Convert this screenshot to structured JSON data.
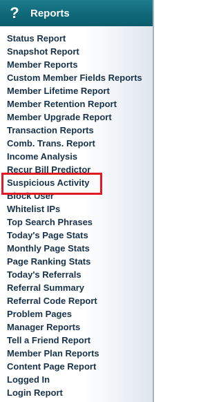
{
  "header": {
    "title": "Reports",
    "icon": "question-mark-icon"
  },
  "menu": {
    "items": [
      "Status Report",
      "Snapshot Report",
      "Member Reports",
      "Custom Member Fields Reports",
      "Member Lifetime Report",
      "Member Retention Report",
      "Member Upgrade Report",
      "Transaction Reports",
      "Comb. Trans. Report",
      "Income Analysis",
      "Recur Bill Predictor",
      "Suspicious Activity",
      "Block User",
      "Whitelist IPs",
      "Top Search Phrases",
      "Today's Page Stats",
      "Monthly Page Stats",
      "Page Ranking Stats",
      "Today's Referrals",
      "Referral Summary",
      "Referral Code Report",
      "Problem Pages",
      "Manager Reports",
      "Tell a Friend Report",
      "Member Plan Reports",
      "Content Page Report",
      "Logged In",
      "Login Report"
    ]
  },
  "colors": {
    "header": "#0f6878",
    "highlight": "#e01b24",
    "link_text": "#17324a"
  }
}
